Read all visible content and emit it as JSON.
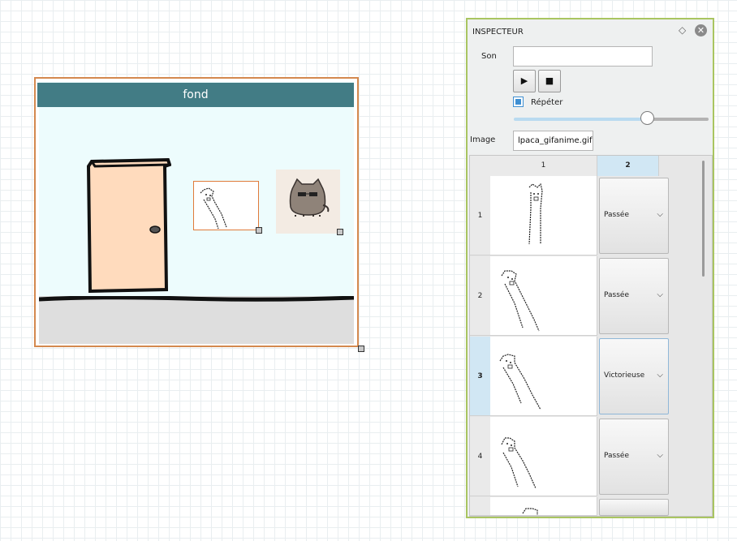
{
  "scene": {
    "title": "fond"
  },
  "inspector": {
    "title": "INSPECTEUR",
    "son_label": "Son",
    "son_value": "",
    "play_icon": "play-icon",
    "stop_icon": "stop-icon",
    "repeat_label": "Répéter",
    "repeat_checked": true,
    "volume_level": 0.74,
    "image_label": "Image",
    "image_value": "lpaca_gifanime.gif",
    "accent": "#a9c561",
    "table": {
      "columns": [
        "1",
        "2"
      ],
      "rows": [
        {
          "index": "1",
          "value": "Passée",
          "selected": false
        },
        {
          "index": "2",
          "value": "Passée",
          "selected": false
        },
        {
          "index": "3",
          "value": "Victorieuse",
          "selected": true
        },
        {
          "index": "4",
          "value": "Passée",
          "selected": false
        }
      ]
    }
  }
}
